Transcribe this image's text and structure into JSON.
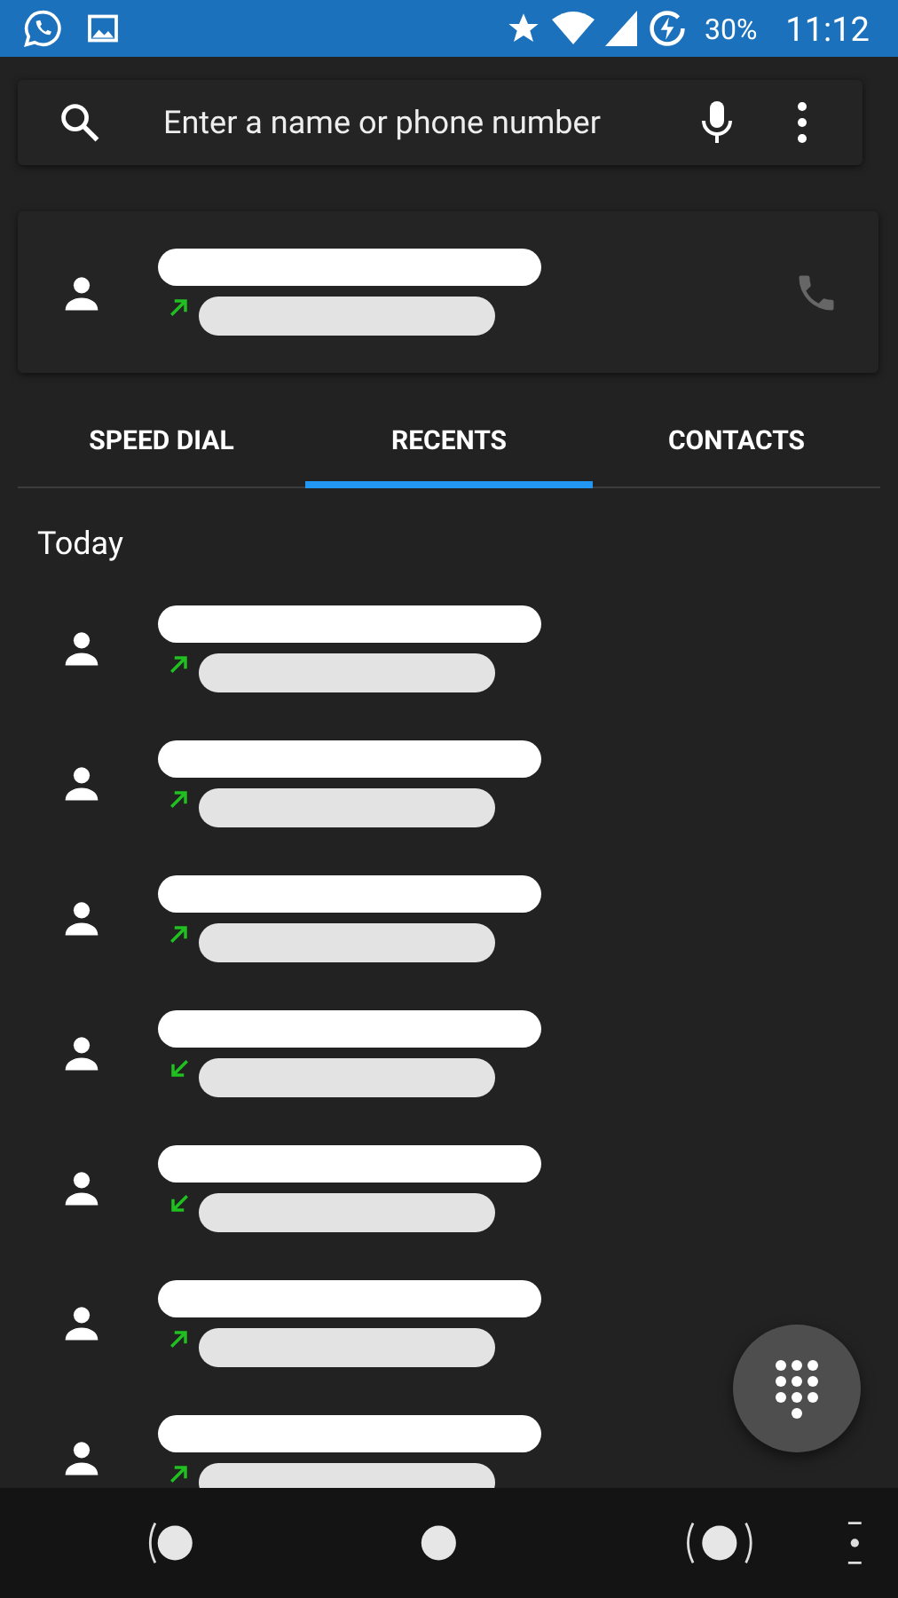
{
  "status_bar": {
    "battery": "30%",
    "time": "11:12"
  },
  "search": {
    "placeholder": "Enter a name or phone number"
  },
  "recent_card": {
    "kind": "outgoing"
  },
  "tabs": [
    {
      "label": "SPEED DIAL",
      "selected": false
    },
    {
      "label": "RECENTS",
      "selected": true
    },
    {
      "label": "CONTACTS",
      "selected": false
    }
  ],
  "section_header": "Today",
  "calls": [
    {
      "kind": "outgoing"
    },
    {
      "kind": "outgoing"
    },
    {
      "kind": "outgoing"
    },
    {
      "kind": "incoming"
    },
    {
      "kind": "incoming"
    },
    {
      "kind": "outgoing"
    },
    {
      "kind": "outgoing"
    }
  ]
}
